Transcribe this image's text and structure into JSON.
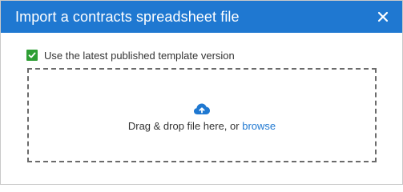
{
  "dialog": {
    "title": "Import a contracts spreadsheet file",
    "close_icon": "close-icon",
    "header_color": "#1f78d1"
  },
  "options": {
    "use_latest_label": "Use the latest published template version",
    "use_latest_checked": true,
    "checkbox_color": "#2e9e34"
  },
  "dropzone": {
    "icon": "cloud-upload-icon",
    "text": "Drag & drop file here, or ",
    "browse_label": "browse",
    "link_color": "#1f78d1"
  }
}
